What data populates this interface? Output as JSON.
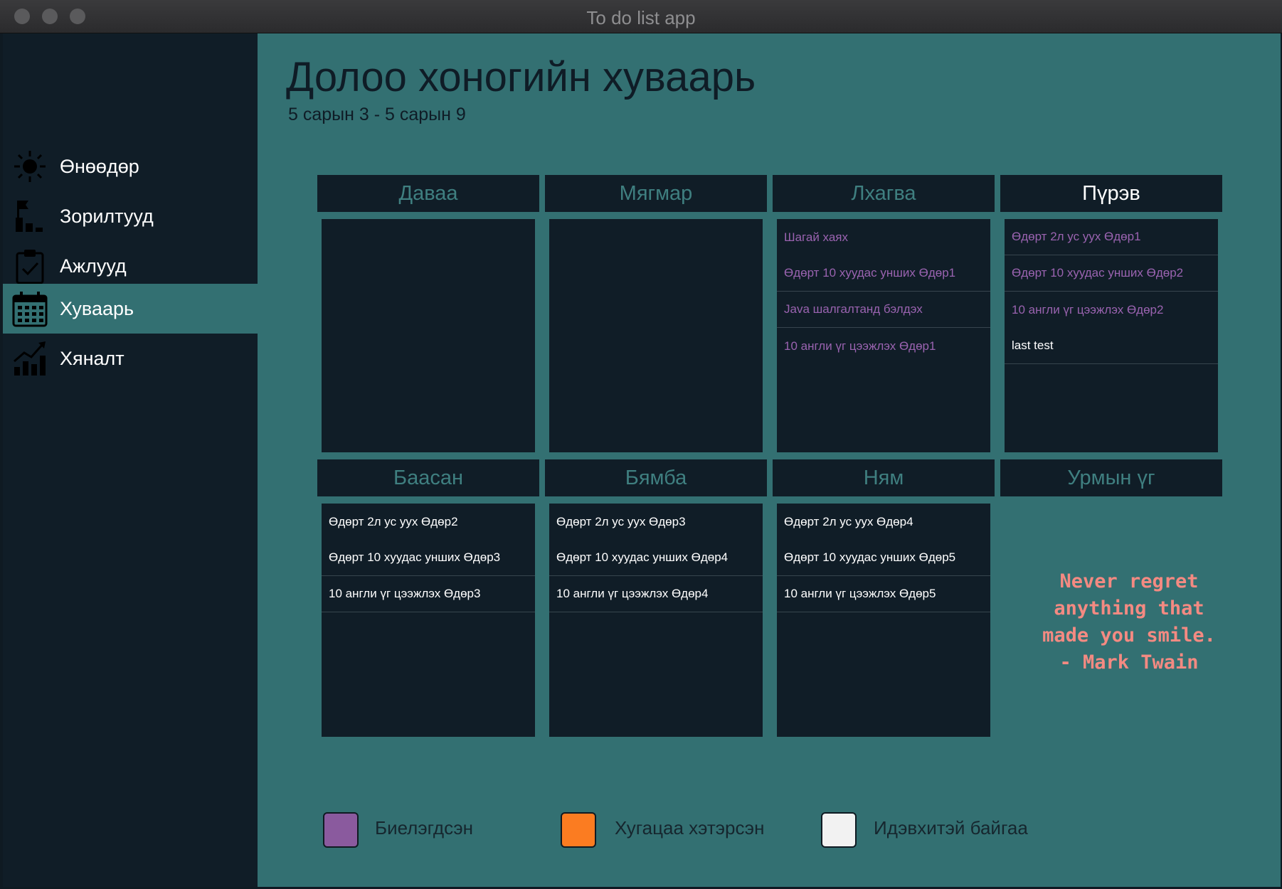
{
  "window": {
    "title": "To do list app"
  },
  "sidebar": {
    "items": [
      {
        "label": "Өнөөдөр",
        "icon": "sun-icon"
      },
      {
        "label": "Зорилтууд",
        "icon": "goals-icon"
      },
      {
        "label": "Ажлууд",
        "icon": "clipboard-check-icon"
      },
      {
        "label": "Хуваарь",
        "icon": "calendar-icon",
        "active": true
      },
      {
        "label": "Хяналт",
        "icon": "chart-growth-icon"
      }
    ]
  },
  "page": {
    "title": "Долоо хоногийн хуваарь",
    "subtitle": "5 сарын 3 - 5 сарын 9"
  },
  "days": [
    {
      "name": "Даваа",
      "tasks": []
    },
    {
      "name": "Мягмар",
      "tasks": []
    },
    {
      "name": "Лхагва",
      "tasks": [
        {
          "text": "Шагай хаях",
          "status": "done"
        },
        {
          "text": "Өдөрт 10 хуудас унших Өдөр1",
          "status": "done"
        },
        {
          "text": "Java шалгалтанд бэлдэх",
          "status": "done"
        },
        {
          "text": "10 англи үг цээжлэх Өдөр1",
          "status": "done"
        }
      ]
    },
    {
      "name": "Пүрэв",
      "today": true,
      "tasks": [
        {
          "text": "Өдөрт 2л ус уух  Өдөр1",
          "status": "done"
        },
        {
          "text": "Өдөрт 10 хуудас унших Өдөр2",
          "status": "done"
        },
        {
          "text": "10 англи үг цээжлэх Өдөр2",
          "status": "done"
        },
        {
          "text": "last test",
          "status": "active"
        }
      ]
    },
    {
      "name": "Баасан",
      "tasks": [
        {
          "text": "Өдөрт 2л ус уух  Өдөр2",
          "status": "active"
        },
        {
          "text": "Өдөрт 10 хуудас унших Өдөр3",
          "status": "active"
        },
        {
          "text": "10 англи үг цээжлэх Өдөр3",
          "status": "active"
        }
      ]
    },
    {
      "name": "Бямба",
      "tasks": [
        {
          "text": "Өдөрт 2л ус уух  Өдөр3",
          "status": "active"
        },
        {
          "text": "Өдөрт 10 хуудас унших Өдөр4",
          "status": "active"
        },
        {
          "text": "10 англи үг цээжлэх Өдөр4",
          "status": "active"
        }
      ]
    },
    {
      "name": "Ням",
      "tasks": [
        {
          "text": "Өдөрт 2л ус уух  Өдөр4",
          "status": "active"
        },
        {
          "text": "Өдөрт 10 хуудас унших Өдөр5",
          "status": "active"
        },
        {
          "text": "10 англи үг цээжлэх Өдөр5",
          "status": "active"
        }
      ]
    }
  ],
  "quote": {
    "header": "Урмын үг",
    "text": "Never regret\nanything that\nmade you smile.\n  - Mark Twain"
  },
  "legend": [
    {
      "label": "Биелэгдсэн",
      "color": "#8a5a9e"
    },
    {
      "label": "Хугацаа хэтэрсэн",
      "color": "#fb7c21"
    },
    {
      "label": "Идэвхитэй байгаа",
      "color": "#f2f2f2"
    }
  ],
  "colors": {
    "accent": "#337072",
    "panel": "#101d27",
    "done_text": "#9a63b0",
    "active_text": "#ffffff",
    "quote_text": "#f48a82"
  }
}
